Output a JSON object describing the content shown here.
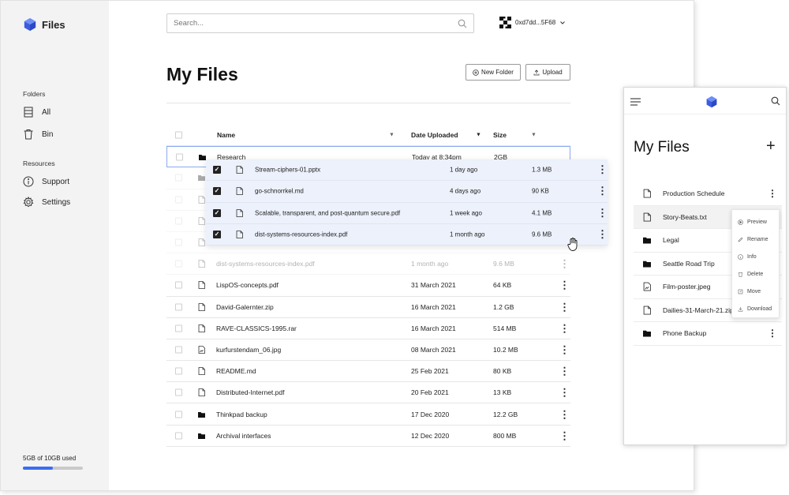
{
  "app": {
    "name": "Files"
  },
  "sidebar": {
    "folders_heading": "Folders",
    "folders": [
      {
        "label": "All",
        "icon": "database-icon"
      },
      {
        "label": "Bin",
        "icon": "trash-icon"
      }
    ],
    "resources_heading": "Resources",
    "resources": [
      {
        "label": "Support",
        "icon": "info-icon"
      },
      {
        "label": "Settings",
        "icon": "gear-icon"
      }
    ],
    "usage_text": "5GB of 10GB used",
    "usage_fraction": 0.5
  },
  "search": {
    "placeholder": "Search..."
  },
  "account": {
    "address": "0xd7dd...5F68"
  },
  "page": {
    "title": "My Files",
    "new_folder": "New Folder",
    "upload": "Upload"
  },
  "table": {
    "headers": {
      "name": "Name",
      "date": "Date Uploaded",
      "size": "Size"
    },
    "rows": [
      {
        "name": "Research",
        "date": "Today at 8:34pm",
        "size": "2GB",
        "type": "folder"
      },
      {
        "name": "",
        "date": "",
        "size": "",
        "type": "folder"
      },
      {
        "name": "",
        "date": "",
        "size": "",
        "type": "file"
      },
      {
        "name": "",
        "date": "",
        "size": "",
        "type": "file"
      },
      {
        "name": "",
        "date": "",
        "size": "",
        "type": "file"
      },
      {
        "name": "dist-systems-resources-index.pdf",
        "date": "1 month ago",
        "size": "9.6 MB",
        "type": "file"
      },
      {
        "name": "LispOS-concepts.pdf",
        "date": "31 March 2021",
        "size": "64 KB",
        "type": "file"
      },
      {
        "name": "David-Galernter.zip",
        "date": "16 March 2021",
        "size": "1.2 GB",
        "type": "file"
      },
      {
        "name": "RAVE-CLASSICS-1995.rar",
        "date": "16 March 2021",
        "size": "514 MB",
        "type": "file"
      },
      {
        "name": "kurfurstendam_06.jpg",
        "date": "08 March 2021",
        "size": "10.2 MB",
        "type": "image"
      },
      {
        "name": "README.md",
        "date": "25 Feb 2021",
        "size": "80 KB",
        "type": "file"
      },
      {
        "name": "Distributed-Internet.pdf",
        "date": "20 Feb 2021",
        "size": "13 KB",
        "type": "file"
      },
      {
        "name": "Thinkpad backup",
        "date": "17 Dec 2020",
        "size": "12.2 GB",
        "type": "folder"
      },
      {
        "name": "Archival interfaces",
        "date": "12 Dec 2020",
        "size": "800 MB",
        "type": "folder"
      }
    ]
  },
  "dragging": [
    {
      "name": "Stream-ciphers-01.pptx",
      "date": "1 day ago",
      "size": "1.3 MB"
    },
    {
      "name": "go-schnorrkel.md",
      "date": "4 days ago",
      "size": "90 KB"
    },
    {
      "name": "Scalable, transparent, and post-quantum secure.pdf",
      "date": "1 week ago",
      "size": "4.1 MB"
    },
    {
      "name": "dist-systems-resources-index.pdf",
      "date": "1 month ago",
      "size": "9.6 MB"
    }
  ],
  "mobile": {
    "title": "My Files",
    "plus": "+",
    "items": [
      {
        "name": "Production Schedule",
        "type": "file"
      },
      {
        "name": "Story-Beats.txt",
        "type": "file"
      },
      {
        "name": "Legal",
        "type": "folder"
      },
      {
        "name": "Seattle Road Trip",
        "type": "folder"
      },
      {
        "name": "Film-poster.jpeg",
        "type": "image"
      },
      {
        "name": "Dailies-31-March-21.zip",
        "type": "file"
      },
      {
        "name": "Phone Backup",
        "type": "folder"
      }
    ],
    "context_menu": [
      "Preview",
      "Rename",
      "Info",
      "Delete",
      "Move",
      "Download"
    ]
  },
  "colors": {
    "accent": "#3b6df2",
    "selection": "#ecf1fb",
    "sidebar_bg": "#f3f3f3"
  }
}
